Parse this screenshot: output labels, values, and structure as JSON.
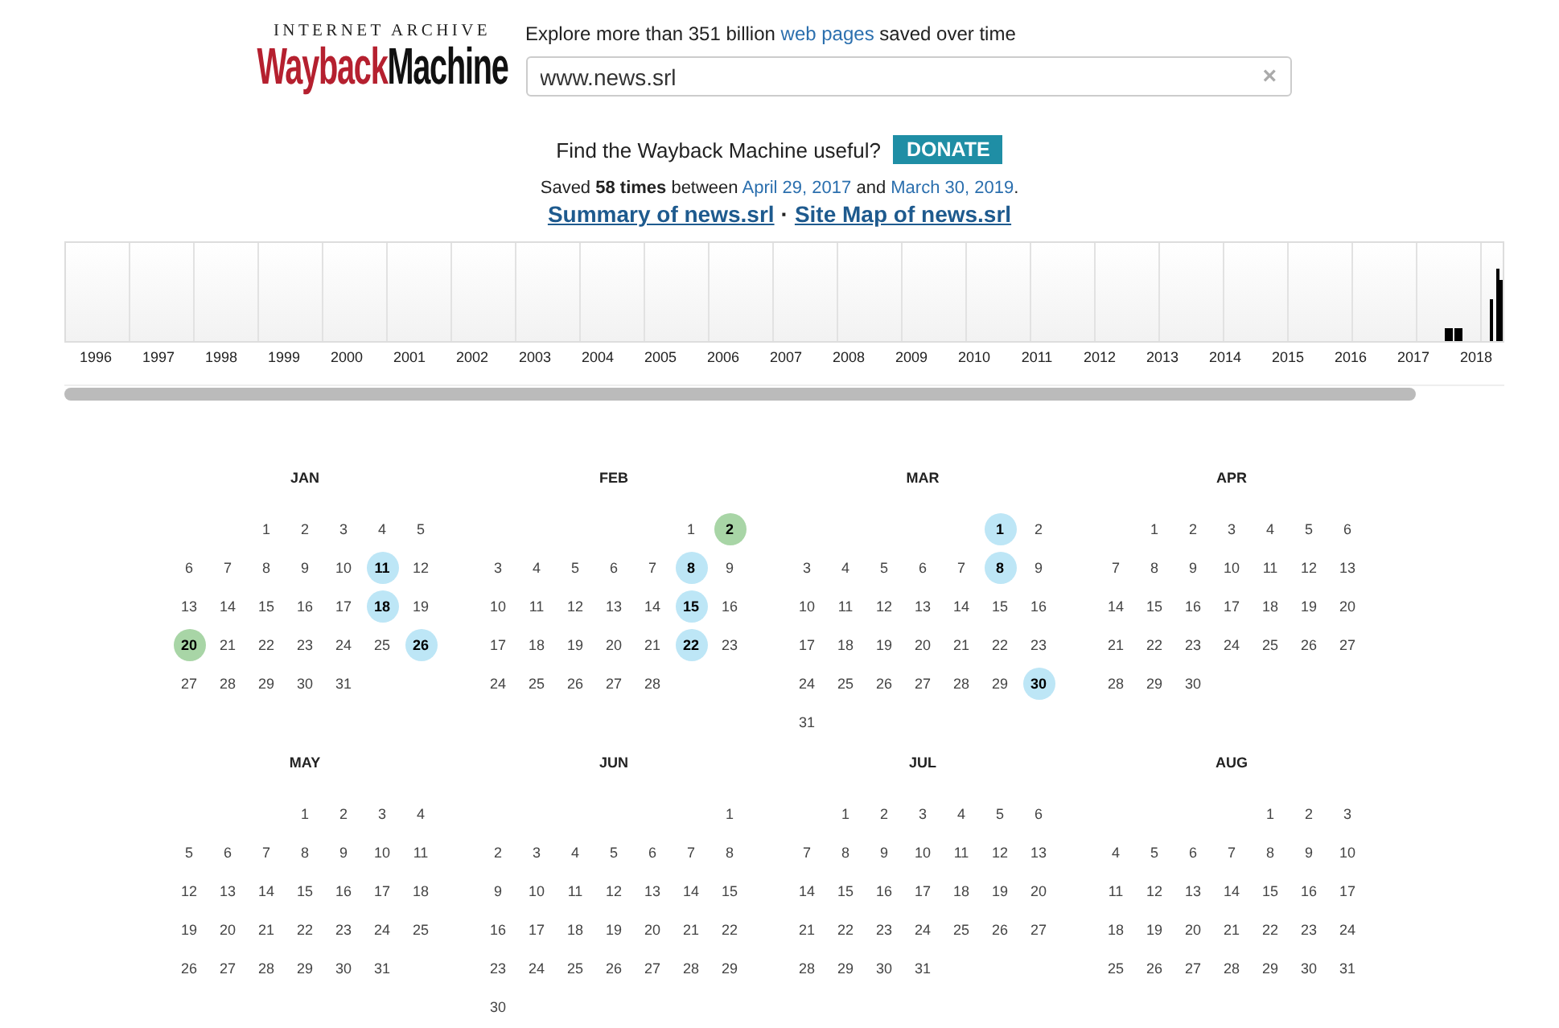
{
  "logo": {
    "top": "INTERNET ARCHIVE",
    "wayback": "Wayback",
    "machine": "Machine"
  },
  "tagline": {
    "before": "Explore more than 351 billion",
    "link": "web pages",
    "after": "saved over time"
  },
  "search": {
    "value": "www.news.srl",
    "clear": "×"
  },
  "donate": {
    "prompt": "Find the Wayback Machine useful?",
    "button": "DONATE"
  },
  "saved": {
    "text": "Saved **58 times** between",
    "first": "April 29, 2017",
    "and": "and",
    "last": "March 30, 2019",
    "end": "."
  },
  "links": [
    {
      "label": "Summary of news.srl"
    },
    {
      "label": "Site Map of news.srl"
    }
  ],
  "link_separator": "·",
  "timeline": {
    "years": [
      {
        "label": "1996",
        "has_captures": false
      },
      {
        "label": "1997",
        "has_captures": false
      },
      {
        "label": "1998",
        "has_captures": false
      },
      {
        "label": "1999",
        "has_captures": false
      },
      {
        "label": "2000",
        "has_captures": false
      },
      {
        "label": "2001",
        "has_captures": false
      },
      {
        "label": "2002",
        "has_captures": false
      },
      {
        "label": "2003",
        "has_captures": false
      },
      {
        "label": "2004",
        "has_captures": false
      },
      {
        "label": "2005",
        "has_captures": false
      },
      {
        "label": "2006",
        "has_captures": false
      },
      {
        "label": "2007",
        "has_captures": false
      },
      {
        "label": "2008",
        "has_captures": false
      },
      {
        "label": "2009",
        "has_captures": false
      },
      {
        "label": "2010",
        "has_captures": false
      },
      {
        "label": "2011",
        "has_captures": false
      },
      {
        "label": "2012",
        "has_captures": false
      },
      {
        "label": "2013",
        "has_captures": false
      },
      {
        "label": "2014",
        "has_captures": false
      },
      {
        "label": "2015",
        "has_captures": false
      },
      {
        "label": "2016",
        "has_captures": false
      },
      {
        "label": "2017",
        "has_captures": true
      },
      {
        "label": "2018",
        "has_captures": true
      }
    ]
  },
  "months": [
    {
      "name": "JAN",
      "weeks": [
        [
          "1",
          "2",
          "3",
          "4",
          "5"
        ],
        [
          "6",
          "7",
          "8",
          "9",
          "10",
          {
            "day": "11",
            "color": "#bde6f6"
          },
          "12"
        ],
        [
          "13",
          "14",
          "15",
          "16",
          "17",
          {
            "day": "18",
            "color": "#bde6f6"
          },
          "19"
        ],
        [
          {
            "day": "20",
            "color": "#a8d5a6"
          },
          "21",
          "22",
          "23",
          "24",
          "25",
          {
            "day": "26",
            "color": "#bde6f6"
          }
        ],
        [
          "27",
          "28",
          "29",
          "30",
          "31"
        ]
      ]
    },
    {
      "name": "FEB",
      "weeks": [
        [
          "1",
          {
            "day": "2",
            "color": "#a8d5a6"
          }
        ],
        [
          "3",
          "4",
          "5",
          "6",
          "7",
          {
            "day": "8",
            "color": "#bde6f6"
          },
          "9"
        ],
        [
          "10",
          "11",
          "12",
          "13",
          "14",
          {
            "day": "15",
            "color": "#bde6f6"
          },
          "16"
        ],
        [
          "17",
          "18",
          "19",
          "20",
          "21",
          {
            "day": "22",
            "color": "#bde6f6"
          },
          "23"
        ],
        [
          "24",
          "25",
          "26",
          "27",
          "28"
        ]
      ]
    },
    {
      "name": "MAR",
      "weeks": [
        [
          {
            "day": "1",
            "color": "#bde6f6"
          },
          "2"
        ],
        [
          "3",
          "4",
          "5",
          "6",
          "7",
          {
            "day": "8",
            "color": "#bde6f6"
          },
          "9"
        ],
        [
          "10",
          "11",
          "12",
          "13",
          "14",
          "15",
          "16"
        ],
        [
          "17",
          "18",
          "19",
          "20",
          "21",
          "22",
          "23"
        ],
        [
          "24",
          "25",
          "26",
          "27",
          "28",
          "29",
          {
            "day": "30",
            "color": "#bde6f6"
          }
        ],
        [
          "31"
        ]
      ]
    },
    {
      "name": "APR",
      "weeks": [
        [
          "1",
          "2",
          "3",
          "4",
          "5",
          "6"
        ],
        [
          "7",
          "8",
          "9",
          "10",
          "11",
          "12",
          "13"
        ],
        [
          "14",
          "15",
          "16",
          "17",
          "18",
          "19",
          "20"
        ],
        [
          "21",
          "22",
          "23",
          "24",
          "25",
          "26",
          "27"
        ],
        [
          "28",
          "29",
          "30"
        ]
      ]
    },
    {
      "name": "MAY",
      "weeks": [
        [
          "1",
          "2",
          "3",
          "4"
        ],
        [
          "5",
          "6",
          "7",
          "8",
          "9",
          "10",
          "11"
        ],
        [
          "12",
          "13",
          "14",
          "15",
          "16",
          "17",
          "18"
        ],
        [
          "19",
          "20",
          "21",
          "22",
          "23",
          "24",
          "25"
        ],
        [
          "26",
          "27",
          "28",
          "29",
          "30",
          "31"
        ]
      ]
    },
    {
      "name": "JUN",
      "weeks": [
        [
          "1"
        ],
        [
          "2",
          "3",
          "4",
          "5",
          "6",
          "7",
          "8"
        ],
        [
          "9",
          "10",
          "11",
          "12",
          "13",
          "14",
          "15"
        ],
        [
          "16",
          "17",
          "18",
          "19",
          "20",
          "21",
          "22"
        ],
        [
          "23",
          "24",
          "25",
          "26",
          "27",
          "28",
          "29"
        ],
        [
          "30"
        ]
      ]
    },
    {
      "name": "JUL",
      "weeks": [
        [
          "1",
          "2",
          "3",
          "4",
          "5",
          "6"
        ],
        [
          "7",
          "8",
          "9",
          "10",
          "11",
          "12",
          "13"
        ],
        [
          "14",
          "15",
          "16",
          "17",
          "18",
          "19",
          "20"
        ],
        [
          "21",
          "22",
          "23",
          "24",
          "25",
          "26",
          "27"
        ],
        [
          "28",
          "29",
          "30",
          "31"
        ]
      ]
    },
    {
      "name": "AUG",
      "weeks": [
        [
          "1",
          "2",
          "3"
        ],
        [
          "4",
          "5",
          "6",
          "7",
          "8",
          "9",
          "10"
        ],
        [
          "11",
          "12",
          "13",
          "14",
          "15",
          "16",
          "17"
        ],
        [
          "18",
          "19",
          "20",
          "21",
          "22",
          "23",
          "24"
        ],
        [
          "25",
          "26",
          "27",
          "28",
          "29",
          "30",
          "31"
        ]
      ]
    }
  ]
}
